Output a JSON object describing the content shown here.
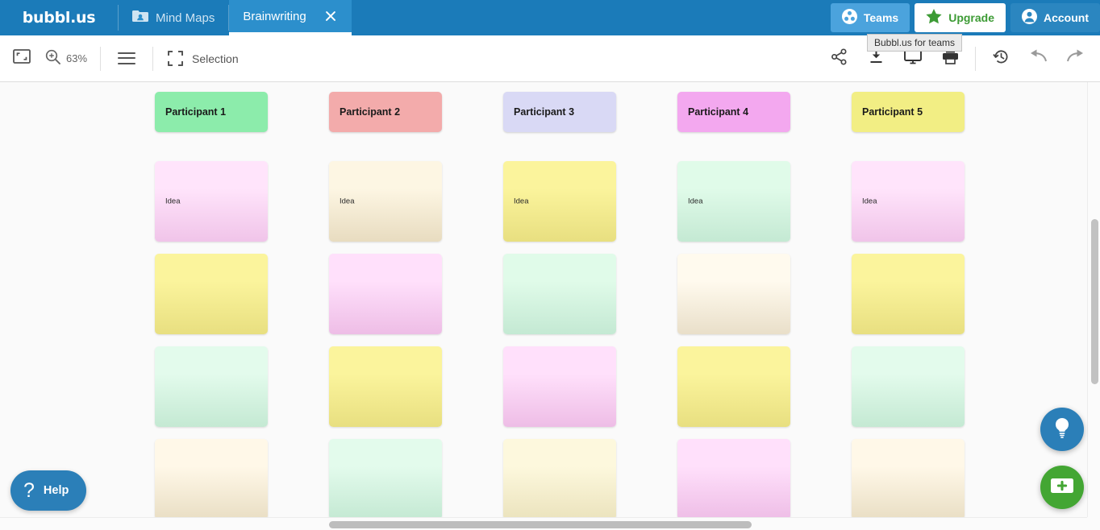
{
  "header": {
    "logo": "bubbl.us",
    "tabs": [
      {
        "label": "Mind Maps",
        "icon": "folder-icon",
        "active": false
      },
      {
        "label": "Brainwriting",
        "icon": "",
        "active": true
      }
    ],
    "buttons": [
      {
        "label": "Teams",
        "icon": "teams-icon",
        "bg": "#4ba3dd",
        "fg": "#ffffff"
      },
      {
        "label": "Upgrade",
        "icon": "star-icon",
        "bg": "#ffffff",
        "fg": "#3d9b35"
      },
      {
        "label": "Account",
        "icon": "account-icon",
        "bg": "#2b86c0",
        "fg": "#ffffff"
      }
    ],
    "tooltip": "Bubbl.us for teams",
    "bar_color": "#1b7bb9"
  },
  "toolbar": {
    "fit_icon": "fit-to-screen-icon",
    "zoom_icon": "zoom-icon",
    "zoom_level": "63%",
    "menu_icon": "hamburger-menu-icon",
    "selection_icon": "selection-marquee-icon",
    "selection_label": "Selection",
    "right_icons": [
      "share-icon",
      "download-icon",
      "present-icon",
      "print-icon",
      "history-icon",
      "undo-icon",
      "redo-icon"
    ]
  },
  "canvas": {
    "columns": [
      {
        "header": "Participant 1",
        "header_color": "#8cecab"
      },
      {
        "header": "Participant 2",
        "header_color": "#f3abab"
      },
      {
        "header": "Participant 3",
        "header_color": "#d9d9f5"
      },
      {
        "header": "Participant 4",
        "header_color": "#f3a8ef"
      },
      {
        "header": "Participant 5",
        "header_color": "#f2ee84"
      }
    ],
    "idea_label": "Idea",
    "rows": [
      {
        "labeled": true,
        "cards": [
          {
            "top": "#ffe4fb",
            "bottom": "#f0c4e9"
          },
          {
            "top": "#fdf6e3",
            "bottom": "#e8dcc0"
          },
          {
            "top": "#fbf49c",
            "bottom": "#e8df80"
          },
          {
            "top": "#e0fbe9",
            "bottom": "#c4e9d3"
          },
          {
            "top": "#ffe4fb",
            "bottom": "#f0c4e9"
          }
        ]
      },
      {
        "labeled": false,
        "cards": [
          {
            "top": "#fbf49c",
            "bottom": "#e8df80"
          },
          {
            "top": "#ffe0fb",
            "bottom": "#eebde6"
          },
          {
            "top": "#e0fbe9",
            "bottom": "#c4e9d3"
          },
          {
            "top": "#fffaee",
            "bottom": "#e9dfc9"
          },
          {
            "top": "#fbf49c",
            "bottom": "#e8df80"
          }
        ]
      },
      {
        "labeled": false,
        "cards": [
          {
            "top": "#e3fbec",
            "bottom": "#c4e9d3"
          },
          {
            "top": "#fbf49c",
            "bottom": "#e8df80"
          },
          {
            "top": "#ffe0fb",
            "bottom": "#eebde6"
          },
          {
            "top": "#fbf49c",
            "bottom": "#e8df80"
          },
          {
            "top": "#e3fbec",
            "bottom": "#c4e9d3"
          }
        ]
      },
      {
        "labeled": false,
        "cards": [
          {
            "top": "#fff8e8",
            "bottom": "#e9dec4"
          },
          {
            "top": "#e3fbec",
            "bottom": "#c4e9d3"
          },
          {
            "top": "#fdf8dd",
            "bottom": "#ebe3bd"
          },
          {
            "top": "#ffe0fb",
            "bottom": "#eebde6"
          },
          {
            "top": "#fff8e8",
            "bottom": "#e9dec4"
          }
        ]
      }
    ]
  },
  "floating": {
    "help_label": "Help",
    "help_icon": "question-mark-icon",
    "idea_icon": "lightbulb-icon",
    "add_icon": "add-card-icon",
    "help_color": "#2b7fb8",
    "idea_color": "#2b7fb8",
    "add_color": "#43a633"
  },
  "scrollbars": {
    "vertical_icon": "vertical-scrollbar",
    "horizontal_icon": "horizontal-scrollbar"
  }
}
